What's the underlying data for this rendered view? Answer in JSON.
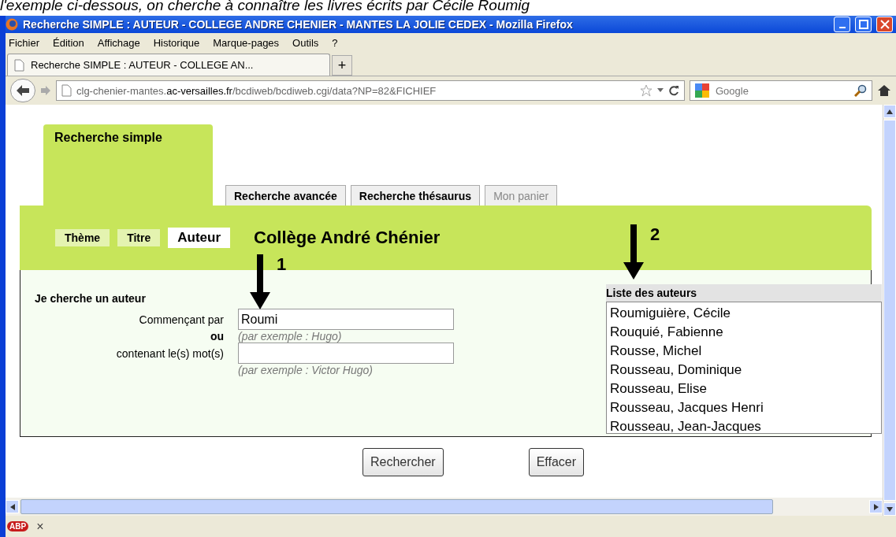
{
  "caption": "l'exemple ci-dessous, on cherche à connaître les livres écrits par Cécile Roumig",
  "window": {
    "title": "Recherche SIMPLE : AUTEUR - COLLEGE ANDRE CHENIER - MANTES LA JOLIE CEDEX - Mozilla Firefox"
  },
  "menu": [
    {
      "label": "Fichier"
    },
    {
      "label": "Édition"
    },
    {
      "label": "Affichage"
    },
    {
      "label": "Historique"
    },
    {
      "label": "Marque-pages"
    },
    {
      "label": "Outils"
    },
    {
      "label": "?"
    }
  ],
  "browser_tabs": [
    {
      "label": "Recherche SIMPLE : AUTEUR - COLLEGE AN...",
      "selected": true
    }
  ],
  "new_tab": "+",
  "address": {
    "prefix": "clg-chenier-mantes.",
    "domain": "ac-versailles.fr",
    "path": "/bcdiweb/bcdiweb.cgi/data?NP=82&FICHIEF"
  },
  "search": {
    "placeholder": "Google"
  },
  "site_tabs": [
    {
      "label": "Recherche simple",
      "selected": true,
      "disabled": false
    },
    {
      "label": "Recherche avancée",
      "selected": false,
      "disabled": false
    },
    {
      "label": "Recherche thésaurus",
      "selected": false,
      "disabled": false
    },
    {
      "label": "Mon panier",
      "selected": false,
      "disabled": true
    }
  ],
  "subtabs": [
    {
      "label": "Thème",
      "selected": false
    },
    {
      "label": "Titre",
      "selected": false
    },
    {
      "label": "Auteur",
      "selected": true
    }
  ],
  "site_title": "Collège André Chénier",
  "form": {
    "heading": "Je cherche un auteur",
    "starts_label": "Commençant par",
    "starts_value": "Roumi",
    "starts_hint": "(par exemple : Hugo)",
    "or": "ou",
    "contains_label": "contenant le(s) mot(s)",
    "contains_hint": "(par exemple : Victor Hugo)"
  },
  "authors": {
    "title": "Liste des auteurs",
    "items": [
      "Roumiguière, Cécile",
      "Rouquié, Fabienne",
      "Rousse, Michel",
      "Rousseau, Dominique",
      "Rousseau, Elise",
      "Rousseau, Jacques Henri",
      "Rousseau, Jean-Jacques"
    ]
  },
  "buttons": [
    {
      "label": "Rechercher"
    },
    {
      "label": "Effacer"
    }
  ],
  "annotations": [
    {
      "label": "1"
    },
    {
      "label": "2"
    }
  ],
  "status_bar": {
    "addon": "ABP",
    "close": "×"
  }
}
